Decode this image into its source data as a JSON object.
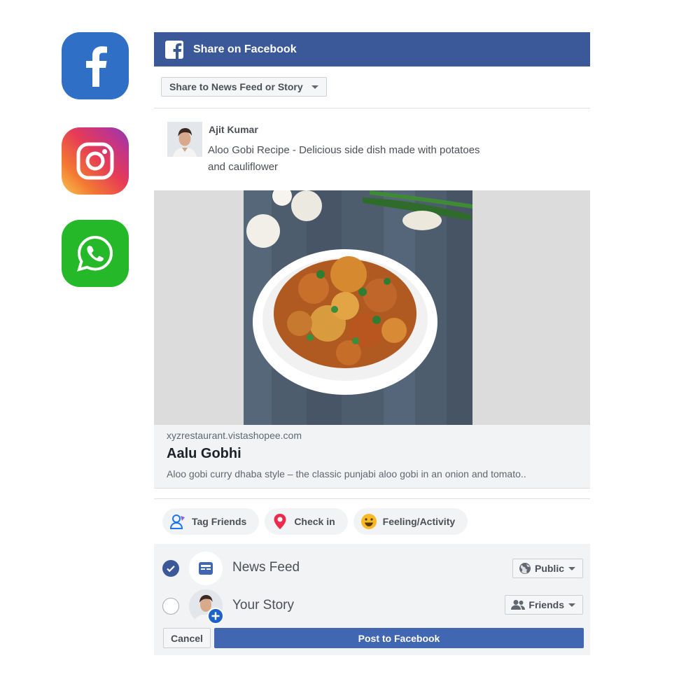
{
  "apps": [
    {
      "name": "Facebook",
      "icon": "facebook-icon",
      "color": "#2f6fc6"
    },
    {
      "name": "Instagram",
      "icon": "instagram-icon",
      "color": "#e63b56"
    },
    {
      "name": "WhatsApp",
      "icon": "whatsapp-icon",
      "color": "#25b929"
    }
  ],
  "dialog": {
    "title": "Share on Facebook",
    "header_color": "#3b5998",
    "share_target": "Share to News Feed or Story",
    "author": "Ajit Kumar",
    "message_line1": "Aloo Gobi Recipe - Delicious side dish made with potatoes",
    "message_line2": "and cauliflower",
    "link": {
      "domain": "xyzrestaurant.vistashopee.com",
      "title": "Aalu Gobhi",
      "description": "Aloo gobi curry dhaba style – the classic punjabi aloo gobi in an onion and tomato.."
    },
    "actions": {
      "tag_friends": "Tag Friends",
      "check_in": "Check in",
      "feeling": "Feeling/Activity"
    },
    "audience": {
      "news_feed": {
        "label": "News Feed",
        "checked": true,
        "privacy": "Public"
      },
      "your_story": {
        "label": "Your Story",
        "checked": false,
        "privacy": "Friends"
      }
    },
    "buttons": {
      "cancel": "Cancel",
      "post": "Post to Facebook",
      "post_color": "#4267b2"
    }
  }
}
